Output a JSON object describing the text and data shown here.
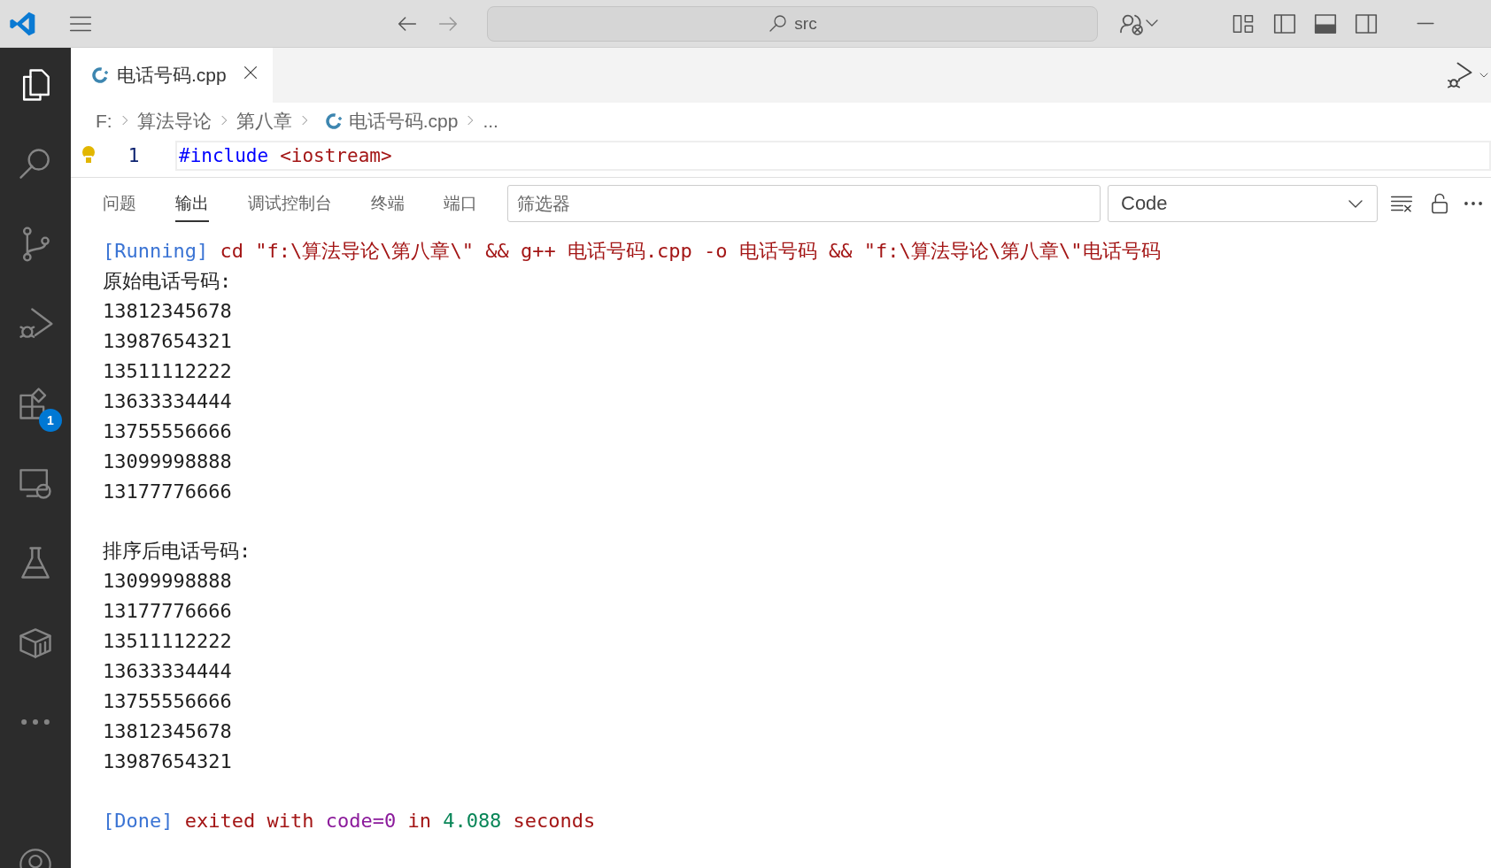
{
  "title_bar": {
    "search": "src"
  },
  "activity_bar": {
    "items": [
      {
        "kind": "files",
        "selected": true
      },
      {
        "kind": "search",
        "selected": false
      },
      {
        "kind": "branch",
        "selected": false
      },
      {
        "kind": "debug",
        "selected": false
      },
      {
        "kind": "extensions",
        "selected": false,
        "badge": "1"
      },
      {
        "kind": "remote",
        "selected": false
      },
      {
        "kind": "flask",
        "selected": false
      },
      {
        "kind": "box",
        "selected": false
      },
      {
        "kind": "more",
        "selected": false
      }
    ]
  },
  "tabs": [
    {
      "label": "电话号码.cpp",
      "selected": true
    }
  ],
  "breadcrumb": [
    {
      "label": "F:",
      "kind": "folder"
    },
    {
      "label": "算法导论",
      "kind": "folder"
    },
    {
      "label": "第八章",
      "kind": "folder"
    },
    {
      "label": "电话号码.cpp",
      "kind": "file"
    },
    {
      "label": "...",
      "kind": "more"
    }
  ],
  "editor": {
    "lines": [
      {
        "number": "1",
        "tokens": [
          {
            "text": "#include",
            "kind": "keyword"
          },
          {
            "text": "<iostream>",
            "kind": "string"
          }
        ]
      }
    ]
  },
  "panel": {
    "tabs": [
      {
        "label": "问题",
        "selected": false
      },
      {
        "label": "输出",
        "selected": true
      },
      {
        "label": "调试控制台",
        "selected": false
      },
      {
        "label": "终端",
        "selected": false
      },
      {
        "label": "端口",
        "selected": false
      }
    ],
    "filter": {
      "placeholder": "筛选器"
    },
    "channel": "Code",
    "output": {
      "blocks": [
        [
          [
            {
              "text": "[Running]",
              "kind": "info"
            },
            {
              "text": " cd \"f:\\算法导论\\第八章\\\" && g++ 电话号码.cpp -o 电话号码 && \"f:\\算法导论\\第八章\\\"电话号码",
              "kind": "error"
            }
          ],
          [
            {
              "text": "原始电话号码:",
              "kind": "plain"
            }
          ],
          [
            {
              "text": "13812345678",
              "kind": "plain"
            }
          ],
          [
            {
              "text": "13987654321",
              "kind": "plain"
            }
          ],
          [
            {
              "text": "13511112222",
              "kind": "plain"
            }
          ],
          [
            {
              "text": "13633334444",
              "kind": "plain"
            }
          ],
          [
            {
              "text": "13755556666",
              "kind": "plain"
            }
          ],
          [
            {
              "text": "13099998888",
              "kind": "plain"
            }
          ],
          [
            {
              "text": "13177776666",
              "kind": "plain"
            }
          ]
        ],
        [
          [
            {
              "text": "排序后电话号码:",
              "kind": "plain"
            }
          ],
          [
            {
              "text": "13099998888",
              "kind": "plain"
            }
          ],
          [
            {
              "text": "13177776666",
              "kind": "plain"
            }
          ],
          [
            {
              "text": "13511112222",
              "kind": "plain"
            }
          ],
          [
            {
              "text": "13633334444",
              "kind": "plain"
            }
          ],
          [
            {
              "text": "13755556666",
              "kind": "plain"
            }
          ],
          [
            {
              "text": "13812345678",
              "kind": "plain"
            }
          ],
          [
            {
              "text": "13987654321",
              "kind": "plain"
            }
          ]
        ],
        [
          [
            {
              "text": "[Done]",
              "kind": "info"
            },
            {
              "text": " exited with ",
              "kind": "error"
            },
            {
              "text": "code=0",
              "kind": "code"
            },
            {
              "text": " in ",
              "kind": "error"
            },
            {
              "text": "4.088",
              "kind": "number"
            },
            {
              "text": " seconds",
              "kind": "error"
            }
          ]
        ]
      ]
    }
  }
}
